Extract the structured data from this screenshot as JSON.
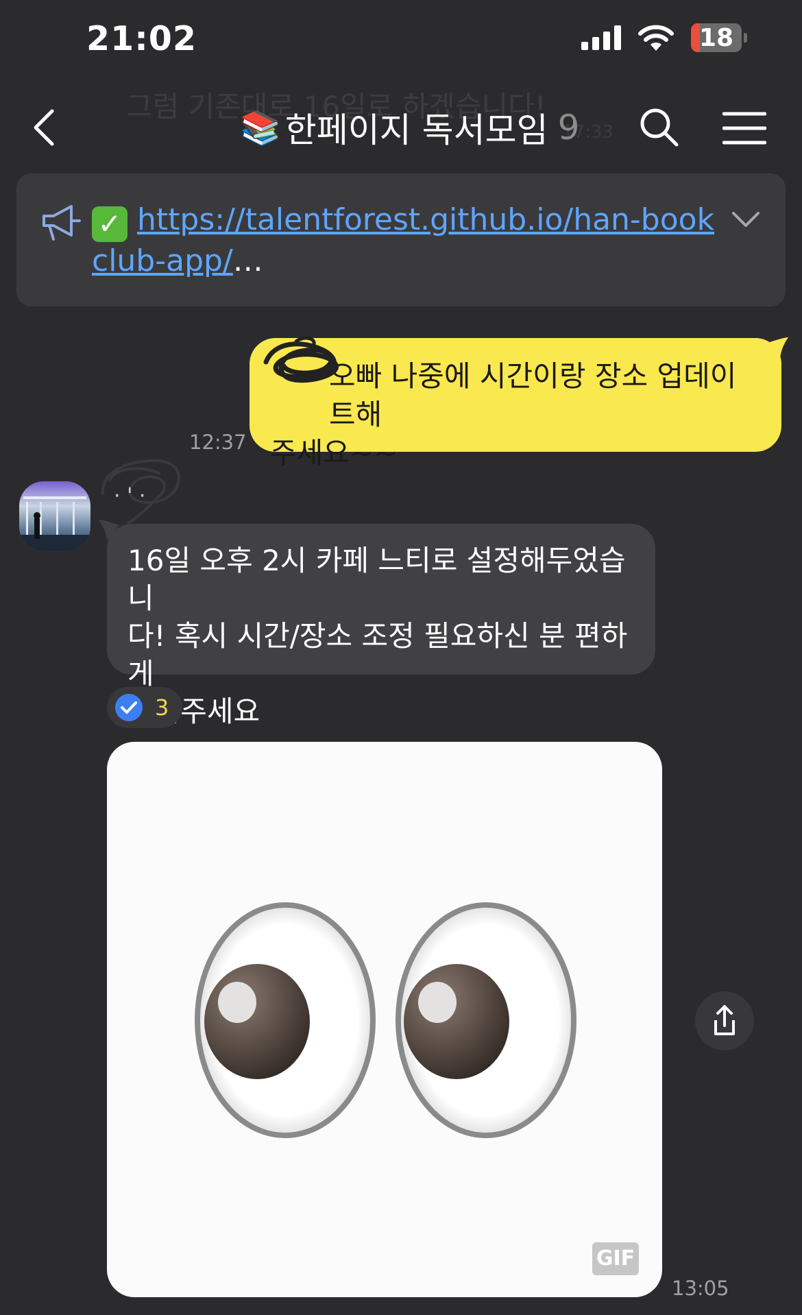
{
  "status_bar": {
    "time": "21:02",
    "battery_level": "18",
    "battery_fraction": 0.18
  },
  "header": {
    "title_emoji": "📚",
    "title": "한페이지 독서모임",
    "member_count": "9",
    "ghost_text": "그럼 기존대로 16일로 하겠습니다!",
    "ghost_time": "17:33"
  },
  "notice": {
    "check_emoji": "✓",
    "link_text": "https://talentforest.github.io/han-bookclub-app/",
    "ellipsis": "…"
  },
  "outgoing_message": {
    "text_line1": "빠 나중에 시간이랑 장소 업데이트해",
    "text_line2": "주세요~~",
    "name_tail": "오",
    "time": "12:37"
  },
  "incoming_message": {
    "sender_name": "· ' ·",
    "text_line1": "16일 오후 2시 카페 느티로 설정해두었습니",
    "text_line2": "다! 혹시 시간/장소 조정 필요하신 분 편하게",
    "text_line3": "말씀주세요",
    "reaction_count": "3"
  },
  "gif_message": {
    "badge": "GIF",
    "time": "13:05"
  },
  "icons": {
    "back": "chevron-left-icon",
    "search": "search-icon",
    "menu": "hamburger-icon",
    "notice": "megaphone-icon",
    "expand": "chevron-down-icon",
    "reaction": "check-circle-icon",
    "share": "share-icon"
  },
  "colors": {
    "background": "#2b2b2d",
    "outgoing_bubble": "#fae84f",
    "incoming_bubble": "#414144",
    "link": "#5fa5ff",
    "notice_bg": "#3a3a3d",
    "reaction_count": "#f4d84a"
  }
}
